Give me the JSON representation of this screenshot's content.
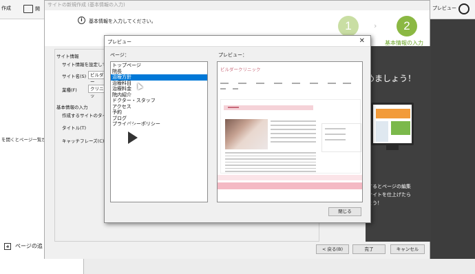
{
  "app": {
    "toolbar_item1": "作成",
    "toolbar_item2": "開",
    "toolbar_right": "プレビュー",
    "left_hint": "を開くとページ一覧が表",
    "add_page_label": "ページの追"
  },
  "wizard": {
    "window_title": "サイトの新規作成 (基本情報の入力)",
    "info_text": "基本情報を入力してください。",
    "step1": "1",
    "step2": "2",
    "step2_label": "基本情報の入力",
    "form": {
      "site_info_group": "サイト情報",
      "site_info_desc": "サイト情報を設定してくた",
      "site_name_label": "サイト名(S)",
      "site_name_value": "ビルダー",
      "industry_label": "業種(F)",
      "industry_value": "クリニッ",
      "basic_info_group": "基本情報の入力",
      "basic_info_desc": "作成するサイトのタイトル",
      "title_label": "タイトル(T)",
      "catch_label": "キャッチフレーズ(C)"
    },
    "right_panel": {
      "heading": "めましょう！",
      "line1": "するとページの編集",
      "line2": "サイトを仕上げたら",
      "line3": "ょう！"
    },
    "buttons": {
      "back": "< 戻る(B)",
      "finish": "完了",
      "cancel": "キャンセル"
    }
  },
  "preview": {
    "title": "プレビュー",
    "close_x": "✕",
    "pages_label": "ページ：",
    "preview_label": "プレビュー：",
    "pages": [
      "トップページ",
      "院長",
      "治療方針",
      "治療科目",
      "治療料金",
      "院内紹介",
      "ドクター・スタッフ",
      "アクセス",
      "予約",
      "ブログ",
      "プライバシーポリシー"
    ],
    "selected_index": 2,
    "site_title": "ビルダークリニック",
    "close_button": "閉じる"
  }
}
